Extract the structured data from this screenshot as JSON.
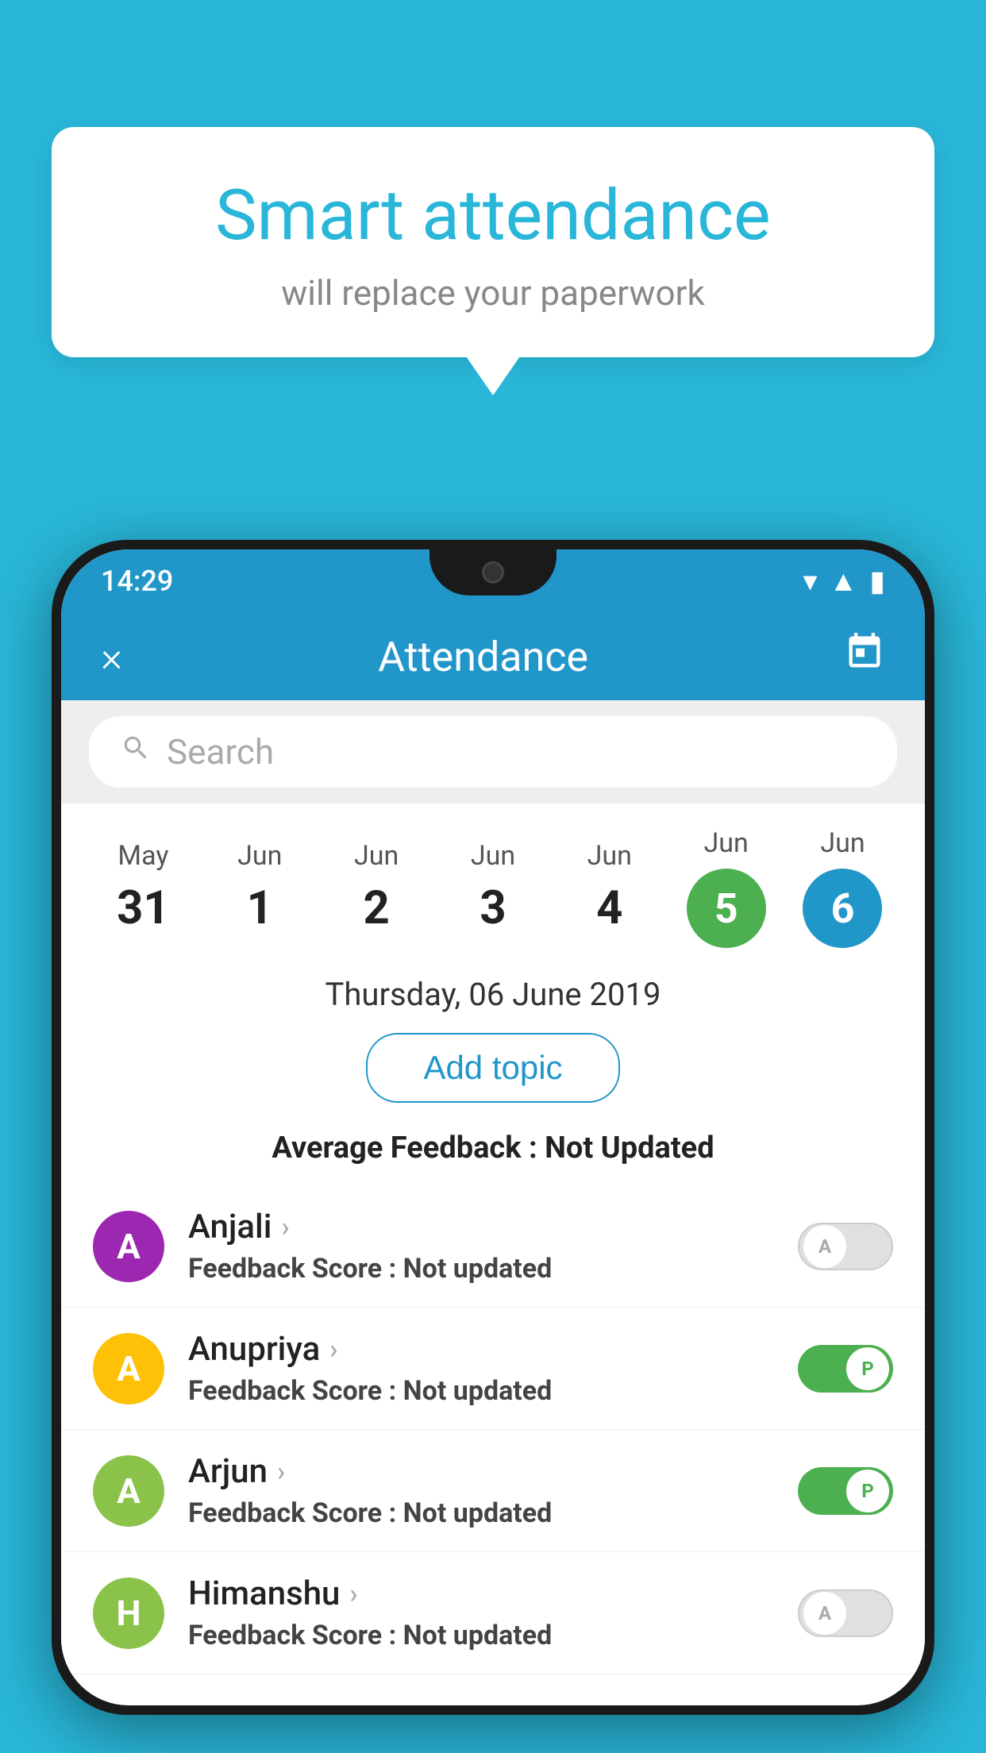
{
  "background_color": "#29b6d8",
  "speech_bubble": {
    "title": "Smart attendance",
    "subtitle": "will replace your paperwork"
  },
  "phone": {
    "status_bar": {
      "time": "14:29"
    },
    "app_bar": {
      "title": "Attendance",
      "close_icon": "×",
      "calendar_icon": "📅"
    },
    "search": {
      "placeholder": "Search"
    },
    "calendar": {
      "dates": [
        {
          "month": "May",
          "day": "31",
          "type": "normal"
        },
        {
          "month": "Jun",
          "day": "1",
          "type": "normal"
        },
        {
          "month": "Jun",
          "day": "2",
          "type": "normal"
        },
        {
          "month": "Jun",
          "day": "3",
          "type": "normal"
        },
        {
          "month": "Jun",
          "day": "4",
          "type": "normal"
        },
        {
          "month": "Jun",
          "day": "5",
          "type": "green"
        },
        {
          "month": "Jun",
          "day": "6",
          "type": "blue"
        }
      ],
      "selected_date": "Thursday, 06 June 2019"
    },
    "add_topic_label": "Add topic",
    "avg_feedback_label": "Average Feedback :",
    "avg_feedback_value": "Not Updated",
    "students": [
      {
        "name": "Anjali",
        "initial": "A",
        "avatar_color": "#9c27b0",
        "feedback_label": "Feedback Score :",
        "feedback_value": "Not updated",
        "attendance": "off",
        "toggle_label": "A"
      },
      {
        "name": "Anupriya",
        "initial": "A",
        "avatar_color": "#ffc107",
        "feedback_label": "Feedback Score :",
        "feedback_value": "Not updated",
        "attendance": "on",
        "toggle_label": "P"
      },
      {
        "name": "Arjun",
        "initial": "A",
        "avatar_color": "#8bc34a",
        "feedback_label": "Feedback Score :",
        "feedback_value": "Not updated",
        "attendance": "on",
        "toggle_label": "P"
      },
      {
        "name": "Himanshu",
        "initial": "H",
        "avatar_color": "#8bc34a",
        "feedback_label": "Feedback Score :",
        "feedback_value": "Not updated",
        "attendance": "off",
        "toggle_label": "A"
      }
    ]
  }
}
